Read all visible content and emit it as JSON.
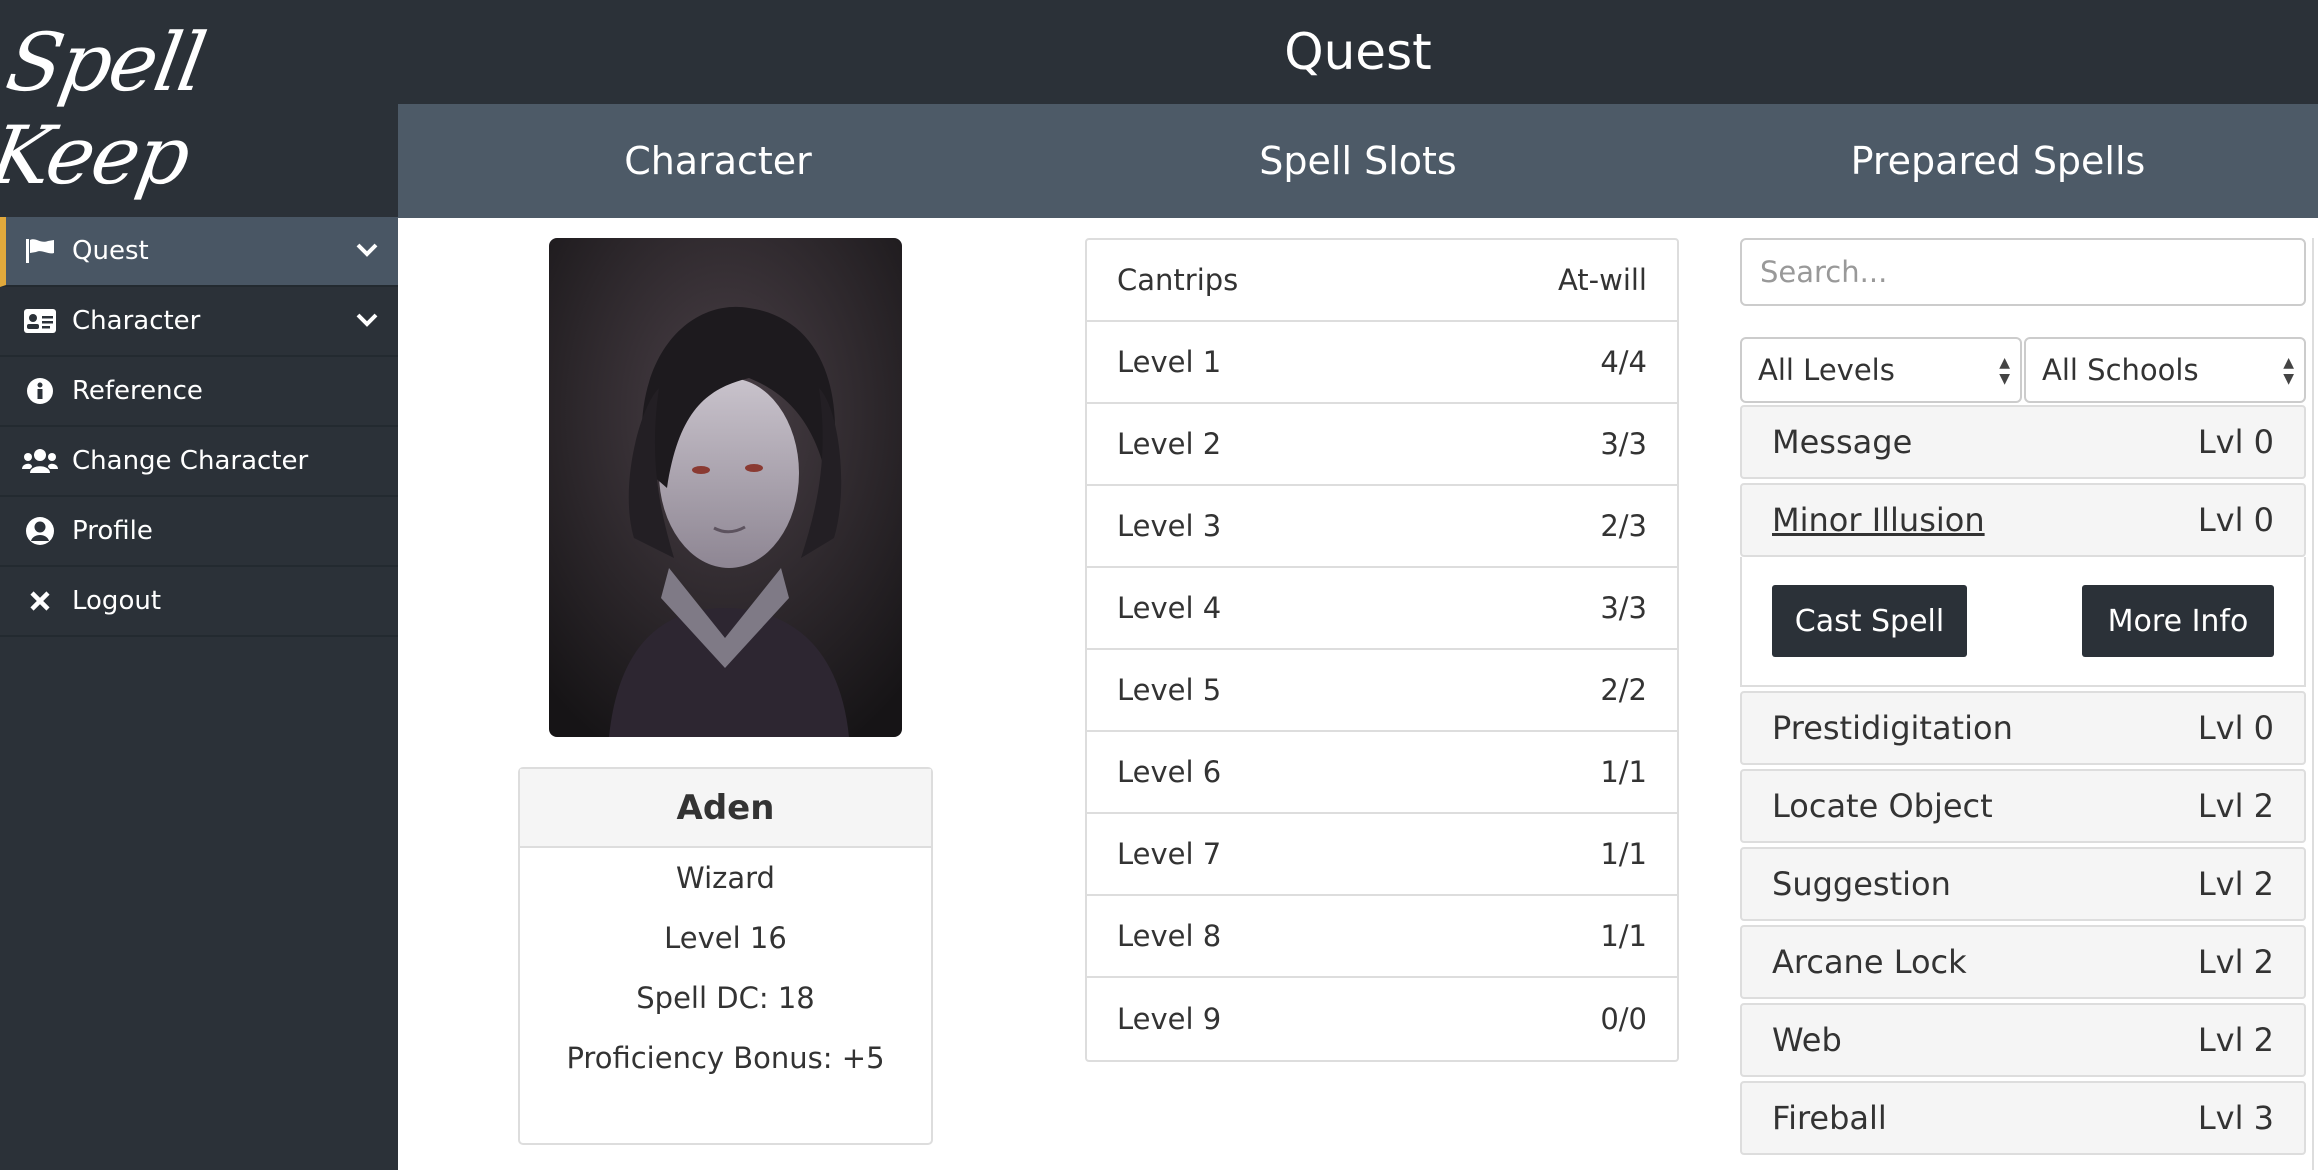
{
  "app": {
    "logo_text": "Spell Keep"
  },
  "sidebar": {
    "items": [
      {
        "label": "Quest",
        "icon": "flag-icon",
        "active": true,
        "has_chevron": true
      },
      {
        "label": "Character",
        "icon": "id-card-icon",
        "active": false,
        "has_chevron": true
      },
      {
        "label": "Reference",
        "icon": "info-circle-icon",
        "active": false,
        "has_chevron": false
      },
      {
        "label": "Change Character",
        "icon": "users-icon",
        "active": false,
        "has_chevron": false
      },
      {
        "label": "Profile",
        "icon": "user-circle-icon",
        "active": false,
        "has_chevron": false
      },
      {
        "label": "Logout",
        "icon": "close-icon",
        "active": false,
        "has_chevron": false
      }
    ]
  },
  "header": {
    "title": "Quest",
    "tabs": [
      {
        "label": "Character"
      },
      {
        "label": "Spell Slots"
      },
      {
        "label": "Prepared Spells"
      }
    ]
  },
  "character": {
    "name": "Aden",
    "class": "Wizard",
    "level": "Level 16",
    "spell_dc": "Spell DC: 18",
    "proficiency": "Proficiency Bonus: +5"
  },
  "spell_slots": [
    {
      "label": "Cantrips",
      "value": "At-will"
    },
    {
      "label": "Level 1",
      "value": "4/4"
    },
    {
      "label": "Level 2",
      "value": "3/3"
    },
    {
      "label": "Level 3",
      "value": "2/3"
    },
    {
      "label": "Level 4",
      "value": "3/3"
    },
    {
      "label": "Level 5",
      "value": "2/2"
    },
    {
      "label": "Level 6",
      "value": "1/1"
    },
    {
      "label": "Level 7",
      "value": "1/1"
    },
    {
      "label": "Level 8",
      "value": "1/1"
    },
    {
      "label": "Level 9",
      "value": "0/0"
    }
  ],
  "prepared": {
    "search_placeholder": "Search...",
    "level_filter": "All Levels",
    "school_filter": "All Schools",
    "spells": [
      {
        "name": "Message",
        "level": "Lvl 0"
      },
      {
        "name": "Minor Illusion",
        "level": "Lvl 0",
        "expanded": true
      },
      {
        "name": "Prestidigitation",
        "level": "Lvl 0"
      },
      {
        "name": "Locate Object",
        "level": "Lvl 2"
      },
      {
        "name": "Suggestion",
        "level": "Lvl 2"
      },
      {
        "name": "Arcane Lock",
        "level": "Lvl 2"
      },
      {
        "name": "Web",
        "level": "Lvl 2"
      },
      {
        "name": "Fireball",
        "level": "Lvl 3"
      }
    ],
    "actions": {
      "cast": "Cast Spell",
      "info": "More Info"
    }
  },
  "colors": {
    "accent": "#e1a93c",
    "dark": "#2b3138",
    "tab_bar": "#4d5a67"
  }
}
